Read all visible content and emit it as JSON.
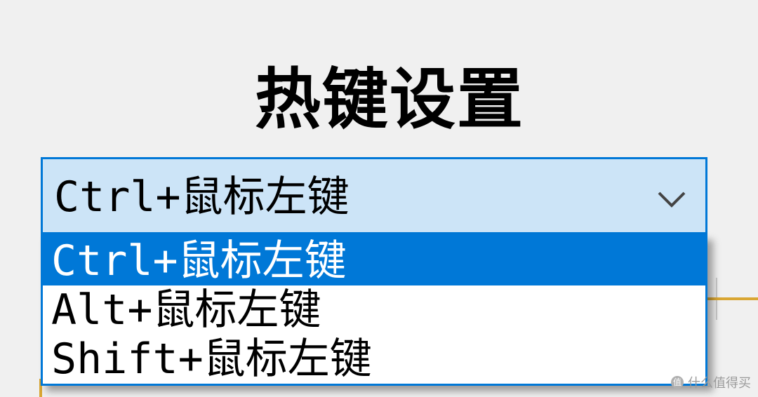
{
  "title": "热键设置",
  "hotkey_select": {
    "selected_value": "Ctrl+鼠标左键",
    "chevron_icon": "chevron-down-icon",
    "options": [
      {
        "label": "Ctrl+鼠标左键",
        "selected": true
      },
      {
        "label": "Alt+鼠标左键",
        "selected": false
      },
      {
        "label": "Shift+鼠标左键",
        "selected": false
      }
    ]
  },
  "watermark": {
    "icon": "值",
    "text": "什么值得买"
  },
  "colors": {
    "accent": "#0078d7",
    "combo_background": "#cce4f7",
    "background": "#f0f0f0",
    "selected_text": "#ffffff"
  }
}
